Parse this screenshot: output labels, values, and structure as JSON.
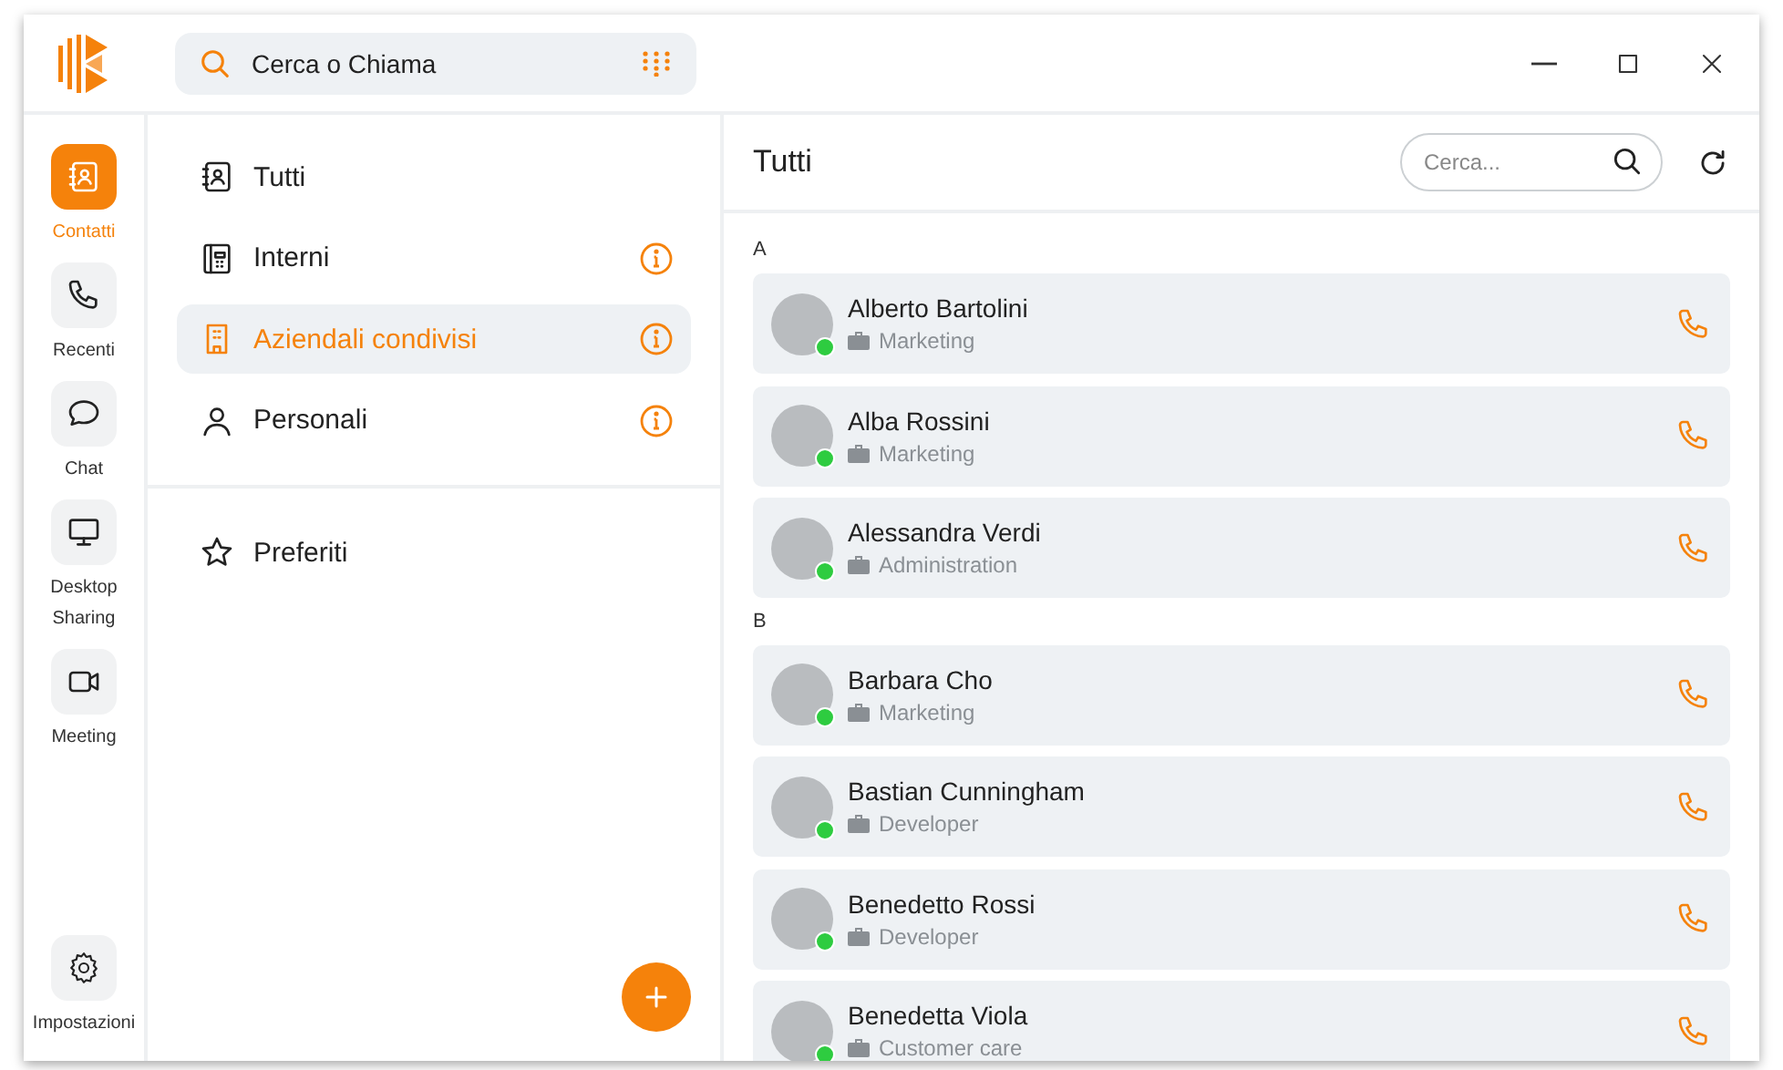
{
  "header": {
    "search": {
      "placeholder": "Cerca o Chiama"
    }
  },
  "rail": {
    "items": [
      {
        "label": "Contatti",
        "selected": true
      },
      {
        "label": "Recenti",
        "selected": false
      },
      {
        "label": "Chat",
        "selected": false
      },
      {
        "label": "Desktop Sharing",
        "selected": false
      },
      {
        "label": "Meeting",
        "selected": false
      }
    ],
    "settings": {
      "label": "Impostazioni"
    }
  },
  "categories": {
    "items": [
      {
        "label": "Tutti",
        "selected": false,
        "info": false
      },
      {
        "label": "Interni",
        "selected": false,
        "info": true
      },
      {
        "label": "Aziendali condivisi",
        "selected": true,
        "info": true
      },
      {
        "label": "Personali",
        "selected": false,
        "info": true
      }
    ],
    "favorites": {
      "label": "Preferiti"
    }
  },
  "contacts": {
    "title": "Tutti",
    "search": {
      "placeholder": "Cerca..."
    },
    "groups": [
      {
        "letter": "A",
        "contacts": [
          {
            "name": "Alberto Bartolini",
            "department": "Marketing",
            "online": true
          },
          {
            "name": "Alba Rossini",
            "department": "Marketing",
            "online": true
          },
          {
            "name": "Alessandra Verdi",
            "department": "Administration",
            "online": true
          }
        ]
      },
      {
        "letter": "B",
        "contacts": [
          {
            "name": "Barbara Cho",
            "department": "Marketing",
            "online": true
          },
          {
            "name": "Bastian Cunningham",
            "department": "Developer",
            "online": true
          },
          {
            "name": "Benedetto Rossi",
            "department": "Developer",
            "online": true
          },
          {
            "name": "Benedetta Viola",
            "department": "Customer care",
            "online": true
          }
        ]
      }
    ]
  }
}
